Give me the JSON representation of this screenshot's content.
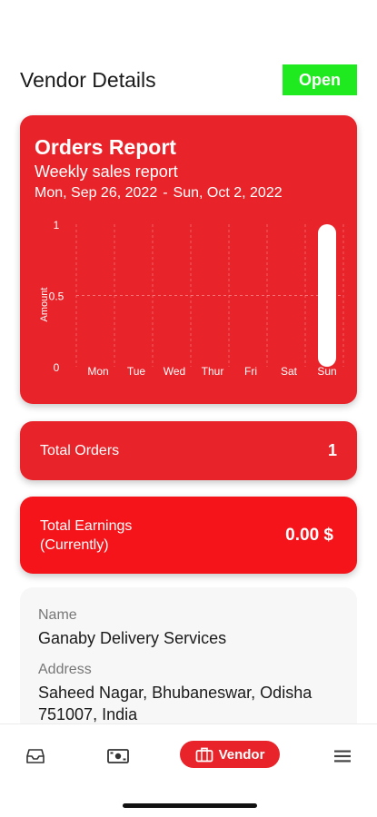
{
  "header": {
    "title": "Vendor Details",
    "status_label": "Open"
  },
  "report": {
    "title": "Orders Report",
    "subtitle": "Weekly sales report",
    "range_start": "Mon, Sep 26, 2022",
    "range_sep": "-",
    "range_end": "Sun, Oct 2, 2022"
  },
  "chart_data": {
    "type": "bar",
    "categories": [
      "Mon",
      "Tue",
      "Wed",
      "Thur",
      "Fri",
      "Sat",
      "Sun"
    ],
    "values": [
      0,
      0,
      0,
      0,
      0,
      0,
      1
    ],
    "ylabel": "Amount",
    "ylim": [
      0,
      1
    ],
    "yticks": [
      "1",
      "0.5",
      "0"
    ],
    "grid": true,
    "bar_color": "#ffffff"
  },
  "stats": {
    "orders_label": "Total Orders",
    "orders_value": "1",
    "earnings_label_1": "Total Earnings",
    "earnings_label_2": "(Currently)",
    "earnings_value": "0.00 $"
  },
  "vendor": {
    "name_label": "Name",
    "name_value": "Ganaby Delivery Services",
    "address_label": "Address",
    "address_value": "Saheed Nagar, Bhubaneswar, Odisha 751007, India"
  },
  "tabbar": {
    "items": [
      {
        "icon": "inbox-icon"
      },
      {
        "icon": "cash-icon"
      },
      {
        "icon": "briefcase-icon",
        "label": "Vendor",
        "active": true
      },
      {
        "icon": "menu-icon"
      }
    ]
  },
  "colors": {
    "accent": "#e8242a",
    "open": "#1fea1f"
  }
}
